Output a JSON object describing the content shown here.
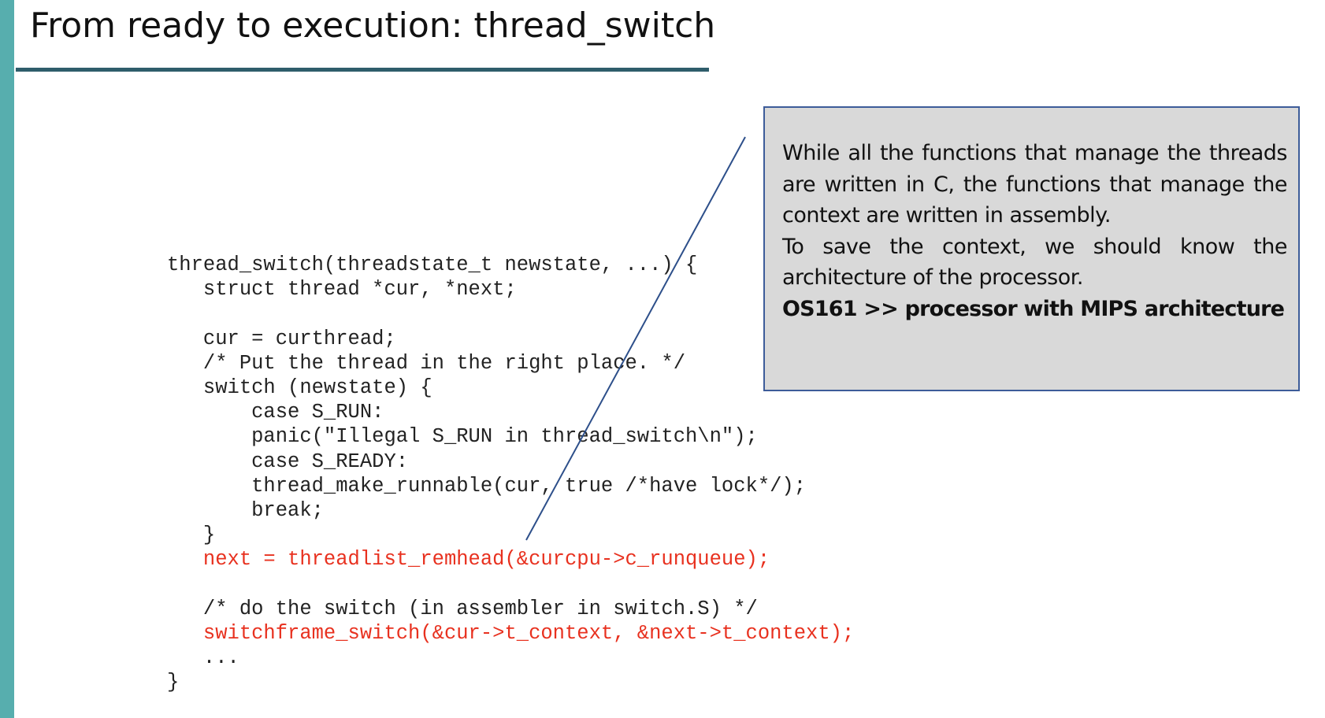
{
  "slide": {
    "title": "From ready to execution: thread_switch",
    "accent_color": "#57aeae",
    "rule_color": "#2f5d6b"
  },
  "code": {
    "lines": [
      {
        "text": "thread_switch(threadstate_t newstate, ...) {",
        "highlight": false
      },
      {
        "text": "   struct thread *cur, *next;",
        "highlight": false
      },
      {
        "text": "",
        "highlight": false
      },
      {
        "text": "   cur = curthread;",
        "highlight": false
      },
      {
        "text": "   /* Put the thread in the right place. */",
        "highlight": false
      },
      {
        "text": "   switch (newstate) {",
        "highlight": false
      },
      {
        "text": "       case S_RUN:",
        "highlight": false
      },
      {
        "text": "       panic(\"Illegal S_RUN in thread_switch\\n\");",
        "highlight": false
      },
      {
        "text": "       case S_READY:",
        "highlight": false
      },
      {
        "text": "       thread_make_runnable(cur, true /*have lock*/);",
        "highlight": false
      },
      {
        "text": "       break;",
        "highlight": false
      },
      {
        "text": "   }",
        "highlight": false
      },
      {
        "text": "   next = threadlist_remhead(&curcpu->c_runqueue);",
        "highlight": true
      },
      {
        "text": "",
        "highlight": false
      },
      {
        "text": "   /* do the switch (in assembler in switch.S) */",
        "highlight": false
      },
      {
        "text": "   switchframe_switch(&cur->t_context, &next->t_context);",
        "highlight": true
      },
      {
        "text": "   ...",
        "highlight": false
      },
      {
        "text": "}",
        "highlight": false
      }
    ],
    "highlight_color": "#e8311f"
  },
  "note": {
    "line1": "While all the functions that manage the threads are written in C, the functions that manage the context are written in assembly.",
    "line2": "To save the context, we should know the architecture of the processor.",
    "line3": "OS161 >> processor with MIPS architecture",
    "background": "#d9d9d9",
    "border_color": "#3d5c99"
  }
}
